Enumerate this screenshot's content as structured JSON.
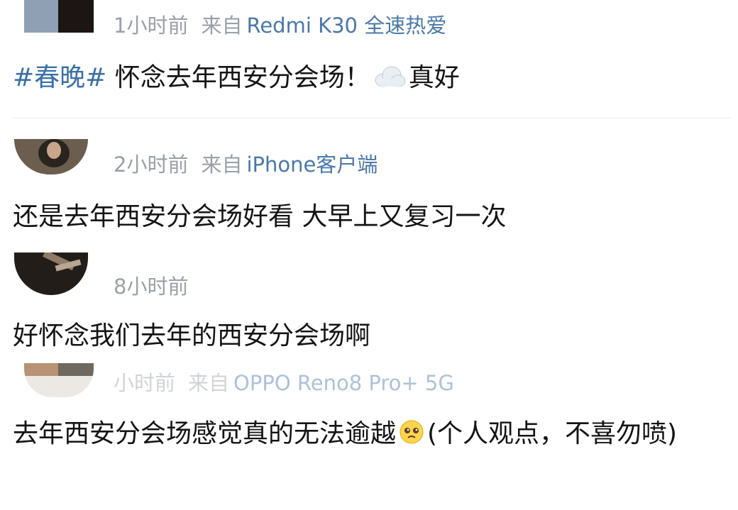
{
  "comments": [
    {
      "time": "1小时前",
      "from_label": "来自",
      "device": "Redmi K30 全速热爱",
      "topic": "#春晚#",
      "text": "怀念去年西安分会场！",
      "emoji_name": "cloud-emoji",
      "text_after": "真好"
    },
    {
      "time": "2小时前",
      "from_label": "来自",
      "device": "iPhone客户端",
      "text": "还是去年西安分会场好看 大早上又复习一次"
    },
    {
      "time": "8小时前",
      "text": "好怀念我们去年的西安分会场啊"
    },
    {
      "time": "小时前",
      "from_label": "来自",
      "device": "OPPO Reno8 Pro+ 5G",
      "text": "去年西安分会场感觉真的无法逾越",
      "emoji_name": "pleading-face-emoji",
      "text_after": "(个人观点，不喜勿喷)"
    }
  ],
  "colors": {
    "meta": "#9aa0a6",
    "device": "#4a78a8",
    "topic": "#3a6fa8",
    "text": "#141414"
  }
}
